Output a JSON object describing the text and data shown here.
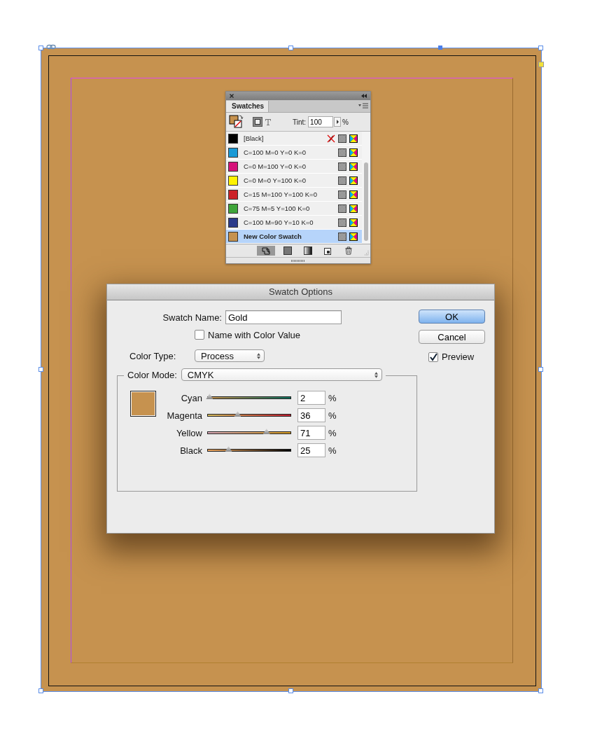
{
  "swatches_panel": {
    "title": "Swatches",
    "tint_label": "Tint:",
    "tint_value": "100",
    "tint_unit": "%",
    "swatches": [
      {
        "name": "[Black]",
        "color": "#000000",
        "selected": false,
        "locked": true
      },
      {
        "name": "C=100 M=0 Y=0 K=0",
        "color": "#1a9ad6",
        "selected": false,
        "locked": false
      },
      {
        "name": "C=0 M=100 Y=0 K=0",
        "color": "#d6127a",
        "selected": false,
        "locked": false
      },
      {
        "name": "C=0 M=0 Y=100 K=0",
        "color": "#fff200",
        "selected": false,
        "locked": false
      },
      {
        "name": "C=15 M=100 Y=100 K=0",
        "color": "#cc2229",
        "selected": false,
        "locked": false
      },
      {
        "name": "C=75 M=5 Y=100 K=0",
        "color": "#3fa53a",
        "selected": false,
        "locked": false
      },
      {
        "name": "C=100 M=90 Y=10 K=0",
        "color": "#2a3a8a",
        "selected": false,
        "locked": false
      },
      {
        "name": "New Color Swatch",
        "color": "#c6924f",
        "selected": true,
        "locked": false
      }
    ]
  },
  "dialog": {
    "title": "Swatch Options",
    "swatch_name_label": "Swatch Name:",
    "swatch_name": "Gold",
    "name_with_color_value": {
      "label": "Name with Color Value",
      "checked": false
    },
    "color_type_label": "Color Type:",
    "color_type": "Process",
    "color_mode_label": "Color Mode:",
    "color_mode": "CMYK",
    "channels": [
      {
        "name": "Cyan",
        "level": 0.02,
        "value": "2",
        "unit": "%"
      },
      {
        "name": "Magenta",
        "level": 0.36,
        "value": "36",
        "unit": "%"
      },
      {
        "name": "Yellow",
        "level": 0.71,
        "value": "71",
        "unit": "%"
      },
      {
        "name": "Black",
        "level": 0.25,
        "value": "25",
        "unit": "%"
      }
    ],
    "buttons": [
      {
        "label": "OK",
        "default": true
      },
      {
        "label": "Cancel",
        "default": false
      }
    ],
    "preview": {
      "label": "Preview",
      "checked": true
    }
  }
}
